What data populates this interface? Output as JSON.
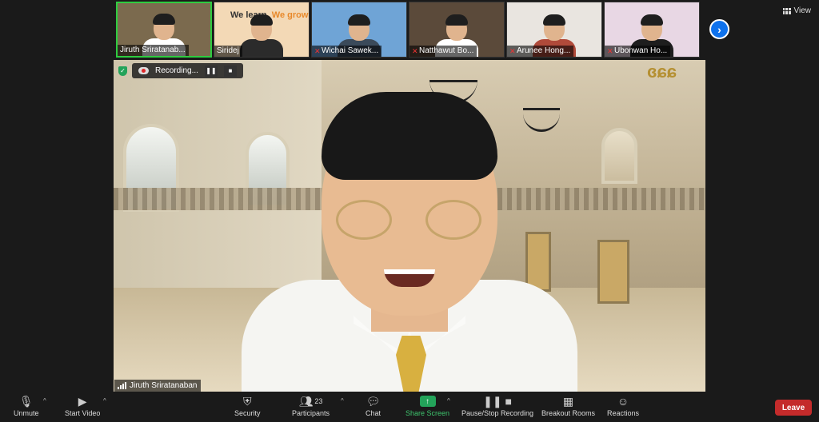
{
  "thumbnails": [
    {
      "name": "Jiruth Sriratanab...",
      "muted": false,
      "active": true,
      "bg": "#7b6a4e",
      "shirt": "#ffffff"
    },
    {
      "name": "Siridej",
      "muted": false,
      "active": false,
      "bg": "#f3d9b6",
      "shirt": "#2b2b2b",
      "slide_text_1": "We learn",
      "slide_text_2": "We grow"
    },
    {
      "name": "Wichai Sawek...",
      "muted": true,
      "active": false,
      "bg": "#6fa4d6",
      "shirt": "#3b4a5a"
    },
    {
      "name": "Natthawut Bo...",
      "muted": true,
      "active": false,
      "bg": "#5b4a3a",
      "shirt": "#ffffff"
    },
    {
      "name": "Arunee Hong...",
      "muted": true,
      "active": false,
      "bg": "#e9e5e0",
      "shirt": "#b04a3a"
    },
    {
      "name": "Ubonwan Ho...",
      "muted": true,
      "active": false,
      "bg": "#e8d7e4",
      "shirt": "#1e1e1e"
    }
  ],
  "view_label": "View",
  "next_page_icon": "chevron-right-icon",
  "recording": {
    "label": "Recording..."
  },
  "main_logo": "ɞɕɕ",
  "active_speaker": "Jiruth Sriratanaban",
  "toolbar": {
    "unmute": "Unmute",
    "start_video": "Start Video",
    "security": "Security",
    "participants": "Participants",
    "participants_count": "23",
    "chat": "Chat",
    "share_screen": "Share Screen",
    "pause_recording": "Pause/Stop Recording",
    "breakout_rooms": "Breakout Rooms",
    "reactions": "Reactions",
    "leave": "Leave"
  },
  "colors": {
    "accent_blue": "#0e72ed",
    "active_green": "#2ecc40",
    "share_green": "#3ec46d",
    "leave_red": "#c42b2b"
  }
}
